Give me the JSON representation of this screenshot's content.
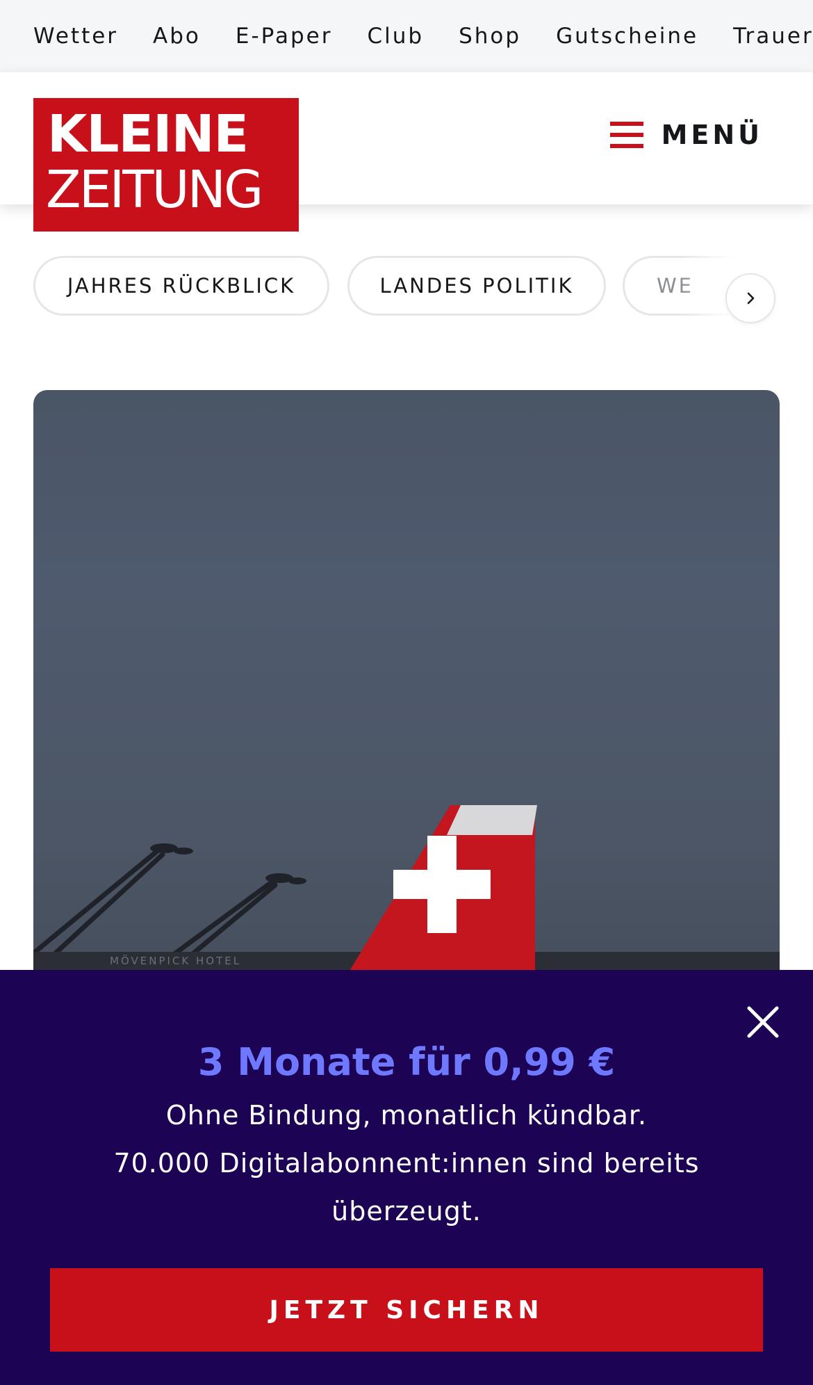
{
  "topbar": {
    "links": [
      "Wetter",
      "Abo",
      "E-Paper",
      "Club",
      "Shop",
      "Gutscheine",
      "Trauerpo"
    ]
  },
  "header": {
    "logo_line1": "KLEINE",
    "logo_line2": "ZEITUNG",
    "menu_label": "MENÜ",
    "brand_color": "#c8101a"
  },
  "categories": {
    "items": [
      "JAHRES RÜCKBLICK",
      "LANDES POLITIK",
      "WE"
    ],
    "arrow_icon": "chevron-right-icon"
  },
  "hero": {
    "image_caption_text": "MÖVENPICK HOTEL"
  },
  "promo": {
    "title": "3 Monate für 0,99 €",
    "line1": "Ohne Bindung, monatlich kündbar.",
    "line2": "70.000 Digitalabonnent:innen sind bereits überzeugt.",
    "cta_label": "JETZT SICHERN",
    "close_icon": "close-icon",
    "background_color": "#1c0354",
    "title_color": "#6f79ff"
  }
}
